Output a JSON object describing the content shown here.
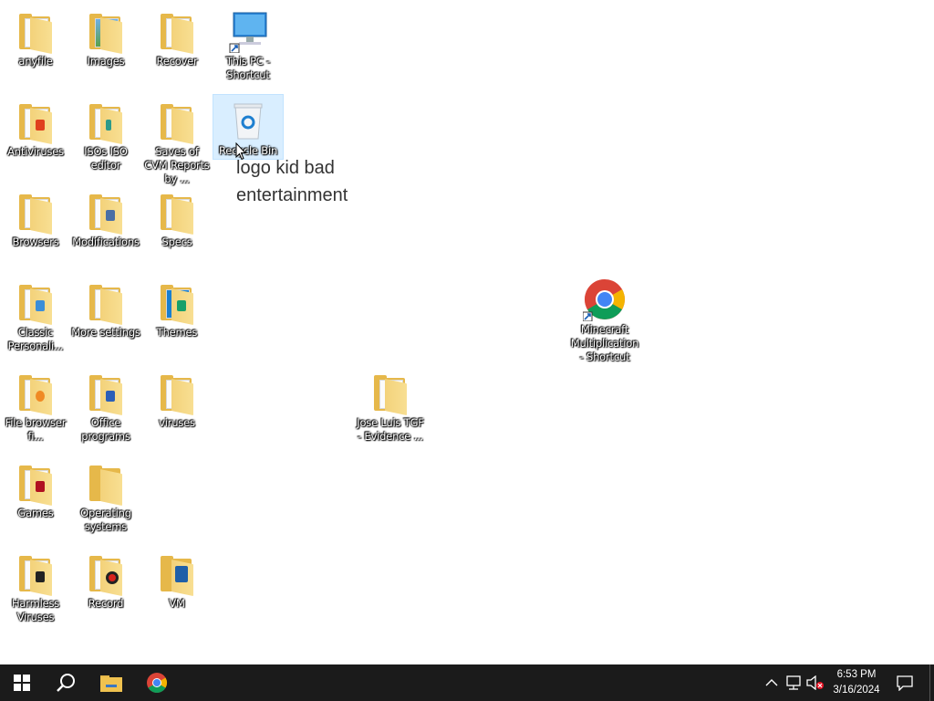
{
  "desktop": {
    "icons": [
      {
        "label": "anyfile"
      },
      {
        "label": "Images"
      },
      {
        "label": "Recover"
      },
      {
        "label": "This PC - Shortcut"
      },
      {
        "label": "Antiviruses"
      },
      {
        "label": "ISOs ISO editor"
      },
      {
        "label": "Saves of CVM Reports by ..."
      },
      {
        "label": "Recycle Bin"
      },
      {
        "label": "Browsers"
      },
      {
        "label": "Modifications"
      },
      {
        "label": "Specs"
      },
      {
        "label": "Classic Personali..."
      },
      {
        "label": "More settings"
      },
      {
        "label": "Themes"
      },
      {
        "label": "Minecraft Multiplication - Shortcut"
      },
      {
        "label": "File browser fi..."
      },
      {
        "label": "Office programs"
      },
      {
        "label": "viruses"
      },
      {
        "label": "Jose Luis TGF - Evidence ..."
      },
      {
        "label": "Games"
      },
      {
        "label": "Operating systems"
      },
      {
        "label": "Harmless Viruses"
      },
      {
        "label": "Record"
      },
      {
        "label": "VM"
      }
    ],
    "tooltip": "logo kid bad entertainment"
  },
  "taskbar": {
    "time": "6:53 PM",
    "date": "3/16/2024"
  },
  "colors": {
    "taskbar_bg": "#1b1b1b",
    "folder": "#e6b84a",
    "selection": "#cce8ff"
  }
}
